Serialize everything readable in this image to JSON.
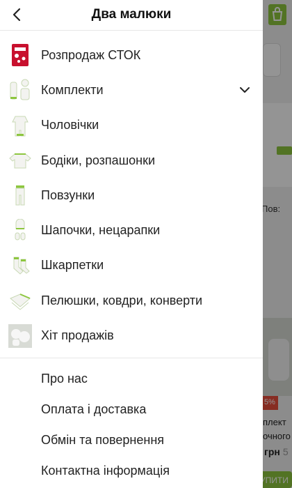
{
  "drawer": {
    "title": "Два малюки",
    "categories": [
      {
        "label": "Розпродаж СТОК",
        "icon": "sale-icon"
      },
      {
        "label": "Комплекти",
        "icon": "set-icon",
        "expandable": true
      },
      {
        "label": "Чоловічки",
        "icon": "romper-icon"
      },
      {
        "label": "Бодіки, розпашонки",
        "icon": "bodysuit-icon"
      },
      {
        "label": "Повзунки",
        "icon": "pants-icon"
      },
      {
        "label": "Шапочки, нецарапки",
        "icon": "hat-icon"
      },
      {
        "label": "Шкарпетки",
        "icon": "socks-icon"
      },
      {
        "label": "Пелюшки, ковдри, конверти",
        "icon": "blanket-icon"
      },
      {
        "label": "Хіт продажів",
        "icon": "bestseller-icon"
      }
    ],
    "info_links": [
      "Про нас",
      "Оплата і доставка",
      "Обмін та повернення",
      "Контактна інформація"
    ]
  },
  "background": {
    "label_partial": "Пов:",
    "badge": "5%",
    "title_line1": "плект",
    "title_line2": "очного",
    "price": "грн",
    "price_old": "5",
    "buy_button": "УПИТИ"
  },
  "colors": {
    "accent": "#8dc63f",
    "sale": "#c8102e",
    "badge": "#e94e3c"
  }
}
